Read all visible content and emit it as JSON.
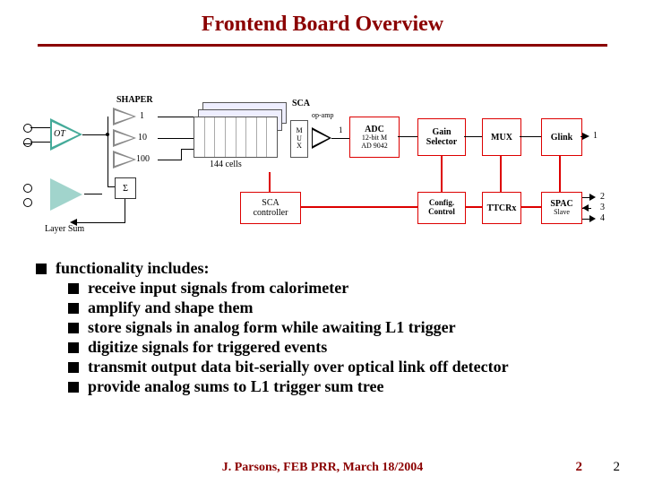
{
  "title": "Frontend Board Overview",
  "diagram": {
    "preamp": "OT",
    "layer_sum": "Layer\nSum",
    "shaper_label": "SHAPER",
    "shaper_gains": [
      "1",
      "10",
      "100"
    ],
    "sigma": "Σ",
    "sca_cells": "144 cells",
    "sca": "SCA",
    "mux_small": "M\nU\nX",
    "sca_controller": "SCA\ncontroller",
    "adc": "ADC",
    "adc_detail": "12-bit M\nAD 9042",
    "gain_selector": "Gain\nSelector",
    "config_control": "Config.\nControl",
    "mux": "MUX",
    "ttcrx": "TTCRx",
    "glink": "Glink",
    "spac": "SPAC",
    "spac_sub": "Slave",
    "out_nums": [
      "1",
      "2",
      "3",
      "4"
    ],
    "arrow_count": "2"
  },
  "bullets": {
    "top": "functionality includes:",
    "items": [
      "receive input signals from calorimeter",
      "amplify and shape them",
      "store signals in analog form while awaiting L1 trigger",
      "digitize signals for triggered events",
      "transmit output data bit-serially over optical link off detector",
      "provide analog sums to L1 trigger sum tree"
    ]
  },
  "footer": {
    "text": "J. Parsons, FEB PRR, March 18/2004",
    "page_red": "2",
    "page_blk": "2"
  }
}
